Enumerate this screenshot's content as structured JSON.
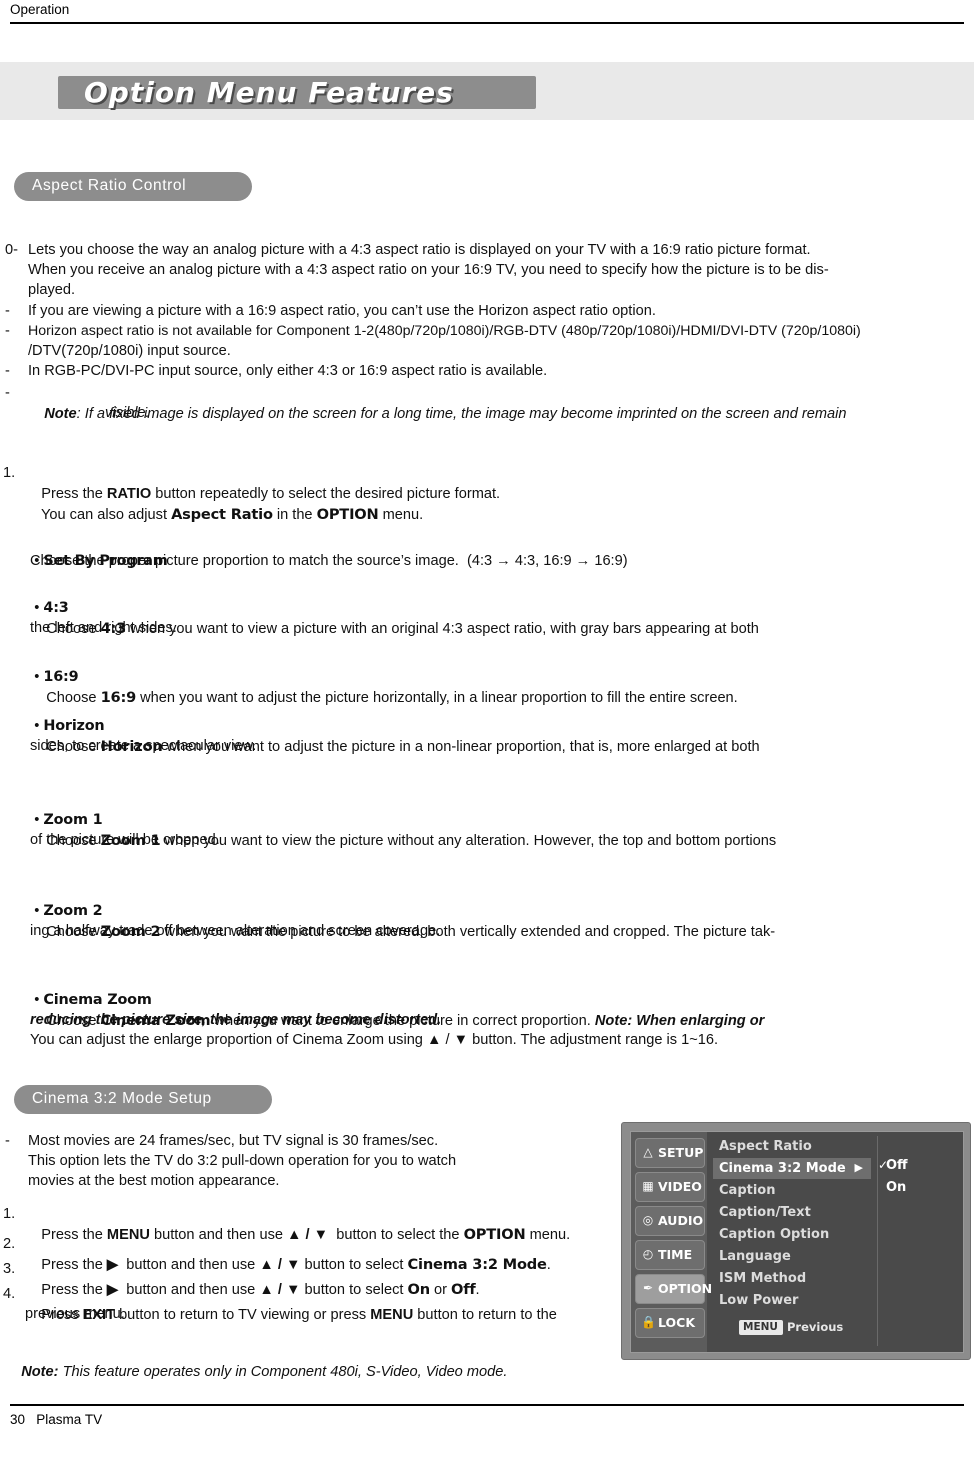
{
  "header": {
    "section": "Operation"
  },
  "title": "Option Menu Features",
  "sections": {
    "aspect": {
      "pill": "Aspect Ratio Control"
    },
    "cinema": {
      "pill": "Cinema 3:2 Mode Setup"
    }
  },
  "aspect_intro": [
    {
      "marker": "0-",
      "text": "Lets you choose the way an analog picture with a 4:3 aspect ratio is displayed on your TV with a 16:9 ratio picture format."
    },
    {
      "marker": "",
      "text": "When you receive an analog picture with a 4:3 aspect ratio on your 16:9 TV, you need to specify how the picture is to be dis-"
    },
    {
      "marker": "",
      "text": "played."
    },
    {
      "marker": "-",
      "text": "If you are viewing a picture with a 16:9 aspect ratio, you can’t use the Horizon aspect ratio option."
    },
    {
      "marker": "-",
      "text": "Horizon aspect ratio is not available for Component 1-2(480p/720p/1080i)/RGB-DTV (480p/720p/1080i)/HDMI/DVI-DTV (720p/1080i)"
    },
    {
      "marker": "",
      "text": "/DTV(720p/1080i) input source."
    },
    {
      "marker": "-",
      "text": "In RGB-PC/DVI-PC input source, only either 4:3 or 16:9 aspect ratio is available."
    }
  ],
  "note_line": {
    "marker": "-",
    "label": "Note",
    "text": ": If a fixed image is displayed on the screen for a long time, the image may become imprinted on the screen and remain",
    "cont": "visible."
  },
  "step1": {
    "num": "1.",
    "p1": "Press the ",
    "b1": "RATIO",
    "p2": " button repeatedly to select the desired picture format.",
    "l2_a": "You can also adjust ",
    "l2_b": "Aspect Ratio",
    "l2_c": " in the ",
    "l2_d": "OPTION",
    "l2_e": " menu."
  },
  "ratio_items": [
    {
      "name": "Set By Program",
      "lines": [
        {
          "pre": "Choose the proper picture proportion to match the source’s image.  (4:3 → 4:3, 16:9 → 16:9)"
        }
      ]
    },
    {
      "name": "4:3",
      "lines": [
        {
          "pre": "Choose ",
          "bold": "4:3",
          "post": " when you want to view a picture with an original 4:3 aspect ratio, with gray bars appearing at both"
        },
        {
          "pre": "the left and right sides."
        }
      ]
    },
    {
      "name": "16:9",
      "lines": [
        {
          "pre": "Choose ",
          "bold": "16:9",
          "post": " when you want to adjust the picture horizontally, in a linear proportion to fill the entire screen."
        }
      ]
    },
    {
      "name": "Horizon",
      "lines": [
        {
          "pre": "Choose ",
          "bold": "Horizon",
          "post": " when you want to adjust the picture in a non-linear proportion, that is, more enlarged at both"
        },
        {
          "pre": "sides, to create a spectacular view."
        }
      ]
    },
    {
      "name": "Zoom 1",
      "lines": [
        {
          "pre": "Choose ",
          "bold": "Zoom 1",
          "post": " when you want to view the picture without any alteration. However, the top and bottom portions"
        },
        {
          "pre": "of the picture will be cropped."
        }
      ]
    },
    {
      "name": "Zoom 2",
      "lines": [
        {
          "pre": "Choose ",
          "bold": "Zoom 2",
          "post": " when you want the picture to be altered, both vertically extended and cropped. The picture tak-"
        },
        {
          "pre": "ing a halfway trade off between alteration and screen coverage."
        }
      ]
    },
    {
      "name": "Cinema Zoom",
      "lines": [
        {
          "pre": "Choose ",
          "bold": "Cinema Zoom",
          "post": " when you want to enlarge the picture in correct proportion. ",
          "italic": "Note: When enlarging or"
        },
        {
          "italic": "reducing the picture size, the image may become distorted."
        },
        {
          "pre": "You can adjust the enlarge proportion of Cinema Zoom using ▲ / ▼ button. The adjustment range is 1~16."
        }
      ]
    }
  ],
  "cinema_intro": [
    {
      "marker": "-",
      "text": "Most movies are 24 frames/sec, but TV signal is 30 frames/sec."
    },
    {
      "marker": "",
      "text": "This option lets the TV do 3:2 pull-down operation for you to watch"
    },
    {
      "marker": "",
      "text": "movies at the best motion appearance."
    }
  ],
  "cinema_steps": [
    {
      "num": "1.",
      "parts": [
        {
          "t": "Press the ",
          "s": "n"
        },
        {
          "t": "MENU",
          "s": "b"
        },
        {
          "t": " button and then use ",
          "s": "n"
        },
        {
          "t": "▲ / ▼",
          "s": "b"
        },
        {
          "t": "  button to select the ",
          "s": "n"
        },
        {
          "t": "OPTION",
          "s": "dj"
        },
        {
          "t": " menu.",
          "s": "n"
        }
      ]
    },
    {
      "num": "2.",
      "parts": [
        {
          "t": "Press the ",
          "s": "n"
        },
        {
          "t": "▶",
          "s": "b"
        },
        {
          "t": "  button and then use ",
          "s": "n"
        },
        {
          "t": "▲ / ▼",
          "s": "b"
        },
        {
          "t": " button to select ",
          "s": "n"
        },
        {
          "t": "Cinema 3:2 Mode",
          "s": "dj"
        },
        {
          "t": ".",
          "s": "n"
        }
      ]
    },
    {
      "num": "3.",
      "parts": [
        {
          "t": "Press the ",
          "s": "n"
        },
        {
          "t": "▶",
          "s": "b"
        },
        {
          "t": "  button and then use ",
          "s": "n"
        },
        {
          "t": "▲ / ▼",
          "s": "b"
        },
        {
          "t": " button to select ",
          "s": "n"
        },
        {
          "t": "On",
          "s": "dj"
        },
        {
          "t": " or ",
          "s": "n"
        },
        {
          "t": "Off",
          "s": "dj"
        },
        {
          "t": ".",
          "s": "n"
        }
      ]
    },
    {
      "num": "4.",
      "parts": [
        {
          "t": "Press ",
          "s": "n"
        },
        {
          "t": "EXIT",
          "s": "b"
        },
        {
          "t": " button to return to TV viewing or press ",
          "s": "n"
        },
        {
          "t": "MENU",
          "s": "b"
        },
        {
          "t": " button to return to the",
          "s": "n"
        }
      ]
    },
    {
      "num": "",
      "parts": [
        {
          "t": "previous menu.",
          "s": "n"
        }
      ]
    }
  ],
  "cinema_note": {
    "label": "Note:",
    "text": " This feature operates only in Component 480i, S-Video, Video mode."
  },
  "osd": {
    "left_items": [
      {
        "label": "SETUP",
        "icon": "antenna-icon",
        "glyph": "ᵀ",
        "selected": false
      },
      {
        "label": "VIDEO",
        "icon": "picture-icon",
        "glyph": "▣",
        "selected": false
      },
      {
        "label": "AUDIO",
        "icon": "speaker-icon",
        "glyph": "◎",
        "selected": false
      },
      {
        "label": "TIME",
        "icon": "clock-icon",
        "glyph": "◔",
        "selected": false
      },
      {
        "label": "OPTION",
        "icon": "wrench-icon",
        "glyph": "✒",
        "selected": true
      },
      {
        "label": "LOCK",
        "icon": "lock-icon",
        "glyph": "Θ",
        "selected": false
      }
    ],
    "menu_items": [
      {
        "label": "Aspect Ratio",
        "highlight": false,
        "arrow": ""
      },
      {
        "label": "Cinema 3:2 Mode",
        "highlight": true,
        "arrow": "▶"
      },
      {
        "label": "Caption",
        "highlight": false,
        "arrow": ""
      },
      {
        "label": "Caption/Text",
        "highlight": false,
        "arrow": ""
      },
      {
        "label": "Caption Option",
        "highlight": false,
        "arrow": ""
      },
      {
        "label": "Language",
        "highlight": false,
        "arrow": ""
      },
      {
        "label": "ISM Method",
        "highlight": false,
        "arrow": ""
      },
      {
        "label": "Low Power",
        "highlight": false,
        "arrow": ""
      }
    ],
    "options": [
      {
        "label": "Off",
        "checked": true
      },
      {
        "label": "On",
        "checked": false
      }
    ],
    "menu_button": "MENU",
    "previous": "Previous"
  },
  "footer": {
    "page": "30",
    "model": "Plasma TV"
  },
  "colors": {
    "band": "#e9e9e9",
    "pill": "#8d8d8d",
    "osd_bg": "#8c8c8c",
    "osd_panel": "#4a4a4a"
  }
}
